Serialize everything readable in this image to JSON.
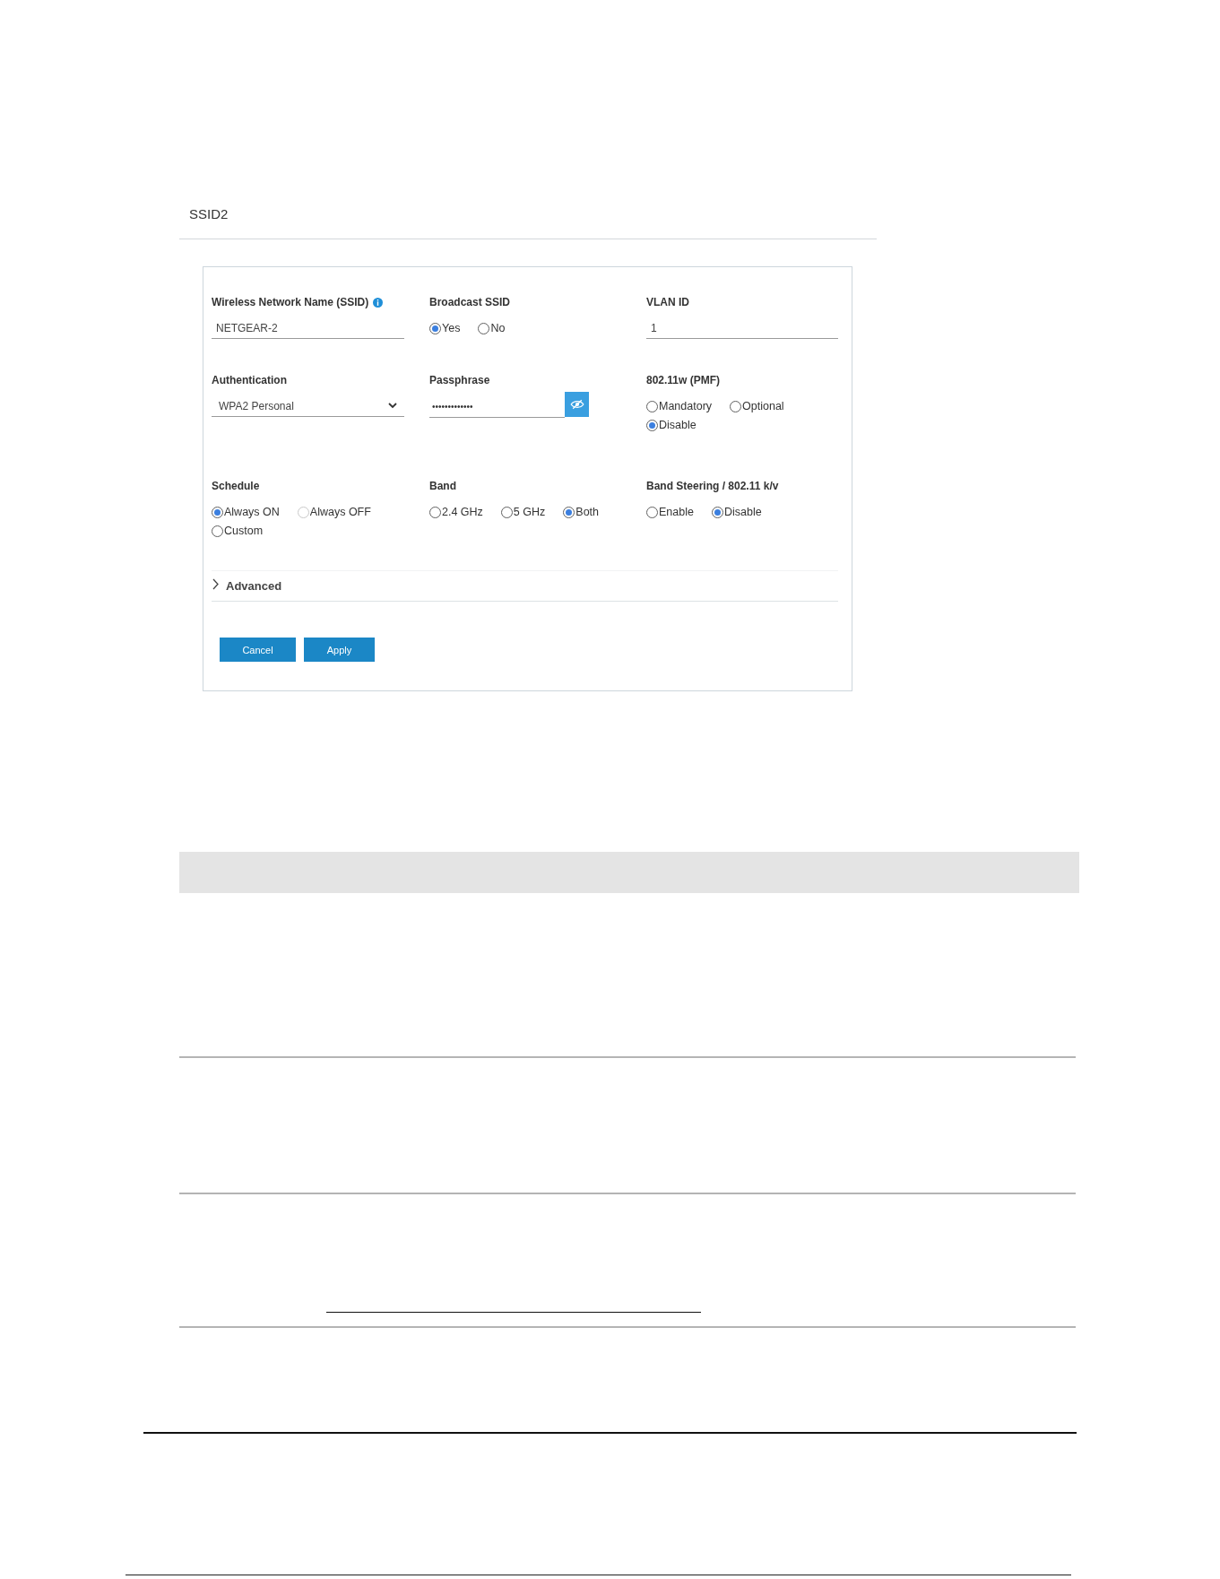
{
  "section": {
    "title": "SSID2"
  },
  "form": {
    "rows": [
      [
        {
          "kind": "text",
          "label": "Wireless Network Name (SSID)",
          "info_icon": true,
          "value": "NETGEAR-2"
        },
        {
          "kind": "radio",
          "label": "Broadcast SSID",
          "options": [
            {
              "label": "Yes",
              "selected": true
            },
            {
              "label": "No",
              "selected": false
            }
          ]
        },
        {
          "kind": "text",
          "label": "VLAN ID",
          "value": "1"
        }
      ],
      [
        {
          "kind": "select",
          "label": "Authentication",
          "value": "WPA2 Personal"
        },
        {
          "kind": "password",
          "label": "Passphrase",
          "value": "•••••••••••••"
        },
        {
          "kind": "radio",
          "label": "802.11w (PMF)",
          "options": [
            {
              "label": "Mandatory",
              "selected": false
            },
            {
              "label": "Optional",
              "selected": false
            },
            {
              "label": "Disable",
              "selected": true
            }
          ]
        }
      ],
      [
        {
          "kind": "radio",
          "label": "Schedule",
          "options": [
            {
              "label": "Always ON",
              "selected": true,
              "disabled": false
            },
            {
              "label": "Always OFF",
              "selected": false,
              "disabled": true
            },
            {
              "label": "Custom",
              "selected": false,
              "disabled": false
            }
          ]
        },
        {
          "kind": "radio",
          "label": "Band",
          "options": [
            {
              "label": "2.4 GHz",
              "selected": false
            },
            {
              "label": "5 GHz",
              "selected": false
            },
            {
              "label": "Both",
              "selected": true
            }
          ]
        },
        {
          "kind": "radio",
          "label": "Band Steering / 802.11 k/v",
          "options": [
            {
              "label": "Enable",
              "selected": false
            },
            {
              "label": "Disable",
              "selected": true
            }
          ]
        }
      ]
    ],
    "advanced": {
      "label": "Advanced",
      "expanded": false
    },
    "buttons": [
      {
        "label": "Cancel"
      },
      {
        "label": "Apply"
      }
    ]
  }
}
